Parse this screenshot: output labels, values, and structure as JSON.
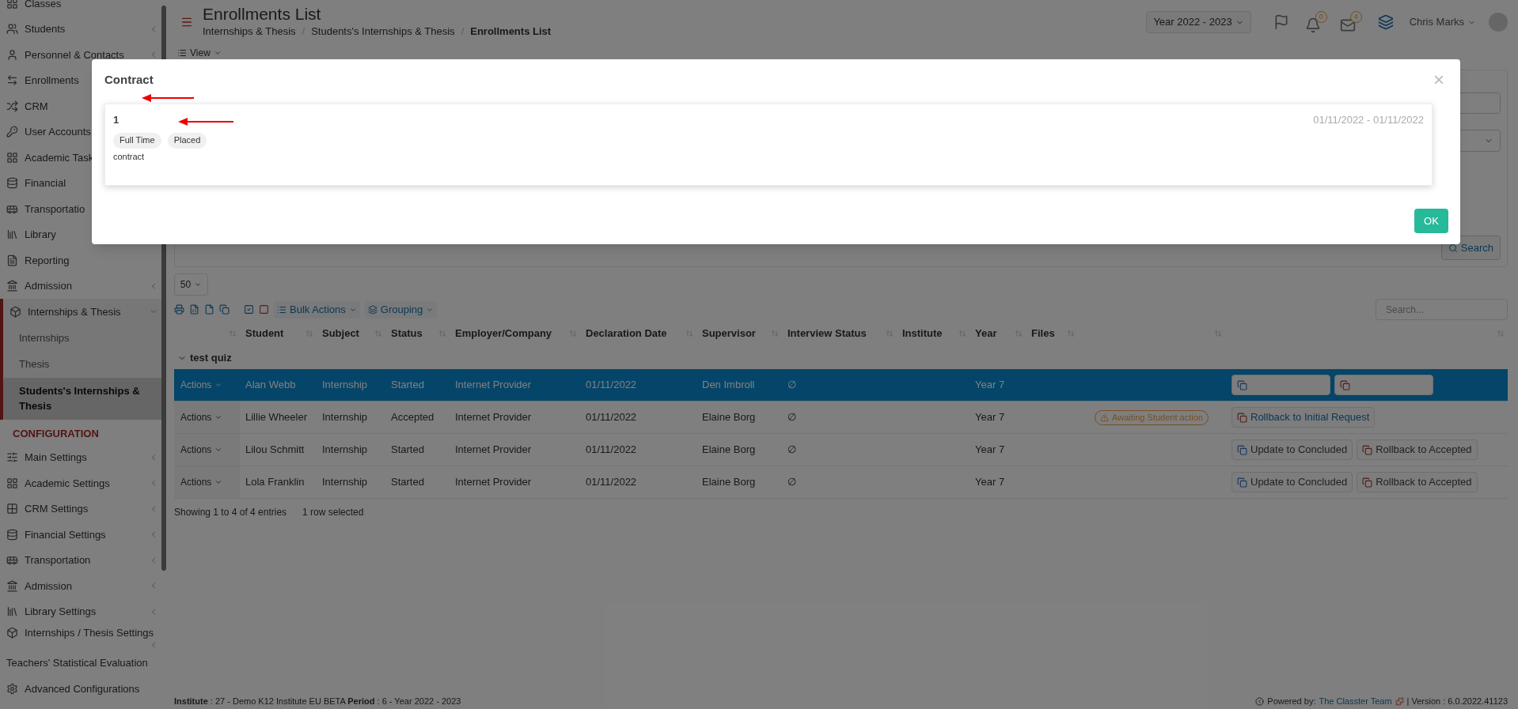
{
  "sidebar": {
    "items": [
      {
        "label": "Classes",
        "submenu": false
      },
      {
        "label": "Students",
        "submenu": true
      },
      {
        "label": "Personnel & Contacts",
        "submenu": true
      },
      {
        "label": "Enrollments"
      },
      {
        "label": "CRM"
      },
      {
        "label": "User Accounts"
      },
      {
        "label": "Academic Task"
      },
      {
        "label": "Financial"
      },
      {
        "label": "Transportatio"
      },
      {
        "label": "Library"
      },
      {
        "label": "Reporting",
        "submenu": false
      },
      {
        "label": "Admission",
        "submenu": true
      },
      {
        "label": "Internships & Thesis",
        "submenu": true,
        "expanded": true,
        "children": [
          {
            "label": "Internships",
            "selected": false
          },
          {
            "label": "Thesis",
            "selected": false
          },
          {
            "label": "Students's Internships & Thesis",
            "selected": true
          }
        ]
      }
    ],
    "section": "CONFIGURATION",
    "config_items": [
      {
        "label": "Main Settings",
        "submenu": true
      },
      {
        "label": "Academic Settings",
        "submenu": true
      },
      {
        "label": "CRM Settings",
        "submenu": true
      },
      {
        "label": "Financial Settings",
        "submenu": true
      },
      {
        "label": "Transportation",
        "submenu": true
      },
      {
        "label": "Admission",
        "submenu": true
      },
      {
        "label": "Library Settings",
        "submenu": true
      },
      {
        "label": "Internships / Thesis Settings",
        "submenu": true
      },
      {
        "label": "Teachers' Statistical Evaluation",
        "submenu": false
      },
      {
        "label": "Advanced Configurations",
        "submenu": false
      }
    ]
  },
  "header": {
    "title": "Enrollments List",
    "separator": "/",
    "breadcrumb": [
      "Internships & Thesis",
      "Students's Internships & Thesis",
      "Enrollments List"
    ],
    "year": "Year 2022 - 2023",
    "notifications": "0",
    "messages": "4",
    "user": "Chris Marks"
  },
  "view_button": "View",
  "search_button": "Search",
  "page_size": "50",
  "toolbar": {
    "bulk_actions": "Bulk Actions",
    "grouping": "Grouping"
  },
  "table": {
    "search_placeholder": "Search...",
    "columns": [
      "Student",
      "Subject",
      "Status",
      "Employer/Company",
      "Declaration Date",
      "Supervisor",
      "Interview Status",
      "Institute",
      "Year",
      "Files"
    ],
    "group": "test quiz",
    "rows": [
      {
        "actions": "Actions",
        "selected": true,
        "cells": [
          "Alan Webb",
          "Internship",
          "Started",
          "Internet Provider",
          "01/11/2022",
          "Den Imbroll",
          "∅",
          "",
          "Year 7",
          ""
        ],
        "buttons": [
          {
            "kind": "update"
          },
          {
            "kind": "rollback"
          }
        ]
      },
      {
        "actions": "Actions",
        "selected": false,
        "cells": [
          "Lillie Wheeler",
          "Internship",
          "Accepted",
          "Internet Provider",
          "01/11/2022",
          "Elaine Borg",
          "∅",
          "",
          "Year 7",
          ""
        ],
        "badge": "Awaiting Student action",
        "buttons": [
          {
            "kind": "rollback_link",
            "label": "Rollback to Initial Request"
          }
        ]
      },
      {
        "actions": "Actions",
        "selected": false,
        "cells": [
          "Lilou Schmitt",
          "Internship",
          "Started",
          "Internet Provider",
          "01/11/2022",
          "Elaine Borg",
          "∅",
          "",
          "Year 7",
          ""
        ],
        "buttons": [
          {
            "kind": "update",
            "label": "Update to Concluded"
          },
          {
            "kind": "rollback",
            "label": "Rollback to Accepted"
          }
        ]
      },
      {
        "actions": "Actions",
        "selected": false,
        "cells": [
          "Lola Franklin",
          "Internship",
          "Started",
          "Internet Provider",
          "01/11/2022",
          "Elaine Borg",
          "∅",
          "",
          "Year 7",
          ""
        ],
        "buttons": [
          {
            "kind": "update",
            "label": "Update to Concluded"
          },
          {
            "kind": "rollback",
            "label": "Rollback to Accepted"
          }
        ]
      }
    ],
    "info": "Showing 1 to 4 of 4 entries",
    "selection_info": "1 row selected"
  },
  "footer": {
    "left": "**Institute** : 27 - Demo K12 Institute EU BETA **Period** : 6 - Year 2022 - 2023",
    "powered": "Powered by:",
    "team": "The Classter Team",
    "version": "| Version : 6.0.2022.41123"
  },
  "modal": {
    "title": "Contract",
    "close": "×",
    "card": {
      "number": "1",
      "dates": "01/11/2022 - 01/11/2022",
      "tags": [
        "Full Time",
        "Placed"
      ],
      "text": "contract"
    },
    "ok": "OK"
  }
}
